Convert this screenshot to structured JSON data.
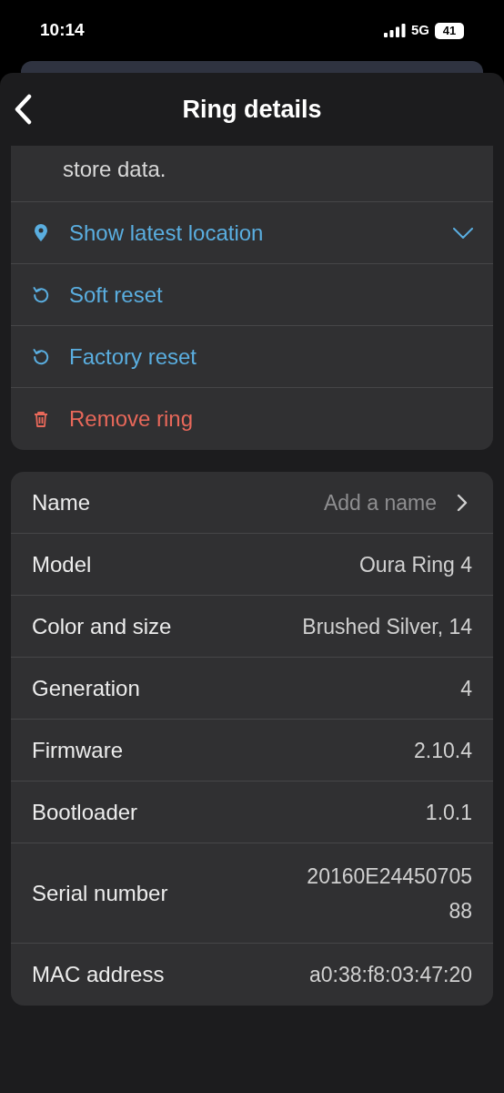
{
  "status_bar": {
    "time": "10:14",
    "network": "5G",
    "battery": "41"
  },
  "header": {
    "title": "Ring details"
  },
  "description_tail": "store data.",
  "actions": [
    {
      "kind": "location",
      "label": "Show latest location",
      "expanded": false
    },
    {
      "kind": "reset",
      "label": "Soft reset"
    },
    {
      "kind": "reset",
      "label": "Factory reset"
    },
    {
      "kind": "remove",
      "label": "Remove ring"
    }
  ],
  "details": [
    {
      "kind": "link",
      "label": "Name",
      "value": "Add a name"
    },
    {
      "kind": "info",
      "label": "Model",
      "value": "Oura Ring 4"
    },
    {
      "kind": "info",
      "label": "Color and size",
      "value": "Brushed Silver, 14"
    },
    {
      "kind": "info",
      "label": "Generation",
      "value": "4"
    },
    {
      "kind": "info",
      "label": "Firmware",
      "value": "2.10.4"
    },
    {
      "kind": "info",
      "label": "Bootloader",
      "value": "1.0.1"
    },
    {
      "kind": "info",
      "label": "Serial number",
      "value": "20160E24450705\n88"
    },
    {
      "kind": "info",
      "label": "MAC address",
      "value": "a0:38:f8:03:47:20"
    }
  ]
}
